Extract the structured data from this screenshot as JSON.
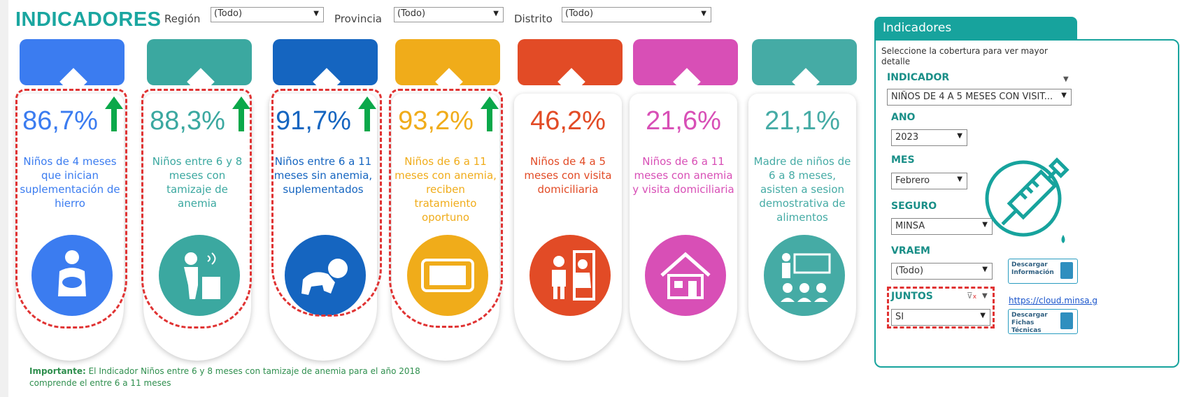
{
  "header": {
    "title": "INDICADORES",
    "filters": [
      {
        "label": "Región",
        "value": "(Todo)"
      },
      {
        "label": "Provincia",
        "value": "(Todo)"
      },
      {
        "label": "Distrito",
        "value": "(Todo)"
      }
    ]
  },
  "indicators": [
    {
      "value": "86,7%",
      "description": "Niños de 4 meses que inician suplementación de hierro",
      "color": "#3b7cf0",
      "icon": "mother-baby-icon",
      "trend": "up",
      "highlighted": true
    },
    {
      "value": "88,3%",
      "description": "Niños entre 6 y 8 meses con tamizaje de anemia",
      "color": "#3ba8a0",
      "icon": "child-testing-icon",
      "trend": "up",
      "highlighted": true
    },
    {
      "value": "91,7%",
      "description": "Niños entre 6 a 11 meses sin anemia, suplementados",
      "color": "#1565c0",
      "icon": "crawling-baby-icon",
      "trend": "up",
      "highlighted": true
    },
    {
      "value": "93,2%",
      "description": "Niños de 6 a 11 meses con anemia, reciben tratamiento oportuno",
      "color": "#f0ac1a",
      "icon": "supplement-pack-icon",
      "trend": "up",
      "highlighted": true
    },
    {
      "value": "46,2%",
      "description": "Niños de 4 a 5 meses con visita domiciliaria",
      "color": "#e24b26",
      "icon": "home-visit-icon",
      "trend": "none",
      "highlighted": false
    },
    {
      "value": "21,6%",
      "description": "Niños de 6 a 11 meses con anemia y visita domiciliaria",
      "color": "#d84fb6",
      "icon": "house-icon",
      "trend": "none",
      "highlighted": false
    },
    {
      "value": "21,1%",
      "description": "Madre de niños de 6 a 8 meses, asisten a sesion demostrativa de alimentos",
      "color": "#45aba5",
      "icon": "demonstration-session-icon",
      "trend": "none",
      "highlighted": false
    }
  ],
  "note": {
    "bold": "Importante:",
    "text": " El Indicador Niños entre 6 y 8 meses con tamizaje de anemia para el año 2018 comprende el entre 6 a 11 meses"
  },
  "panel": {
    "tab_title": "Indicadores",
    "instruction": "Seleccione la cobertura para ver mayor detalle",
    "indicador_label": "INDICADOR",
    "indicador_value": "NIÑOS DE 4 A 5 MESES CON VISIT...",
    "ano_label": "ANO",
    "ano_value": "2023",
    "mes_label": "MES",
    "mes_value": "Febrero",
    "seguro_label": "SEGURO",
    "seguro_value": "MINSA",
    "vraem_label": "VRAEM",
    "vraem_value": "(Todo)",
    "juntos_label": "JUNTOS",
    "juntos_value": "SI",
    "download_info": "Descargar Información",
    "download_sheets": "Descargar Fichas Técnicas",
    "link": "https://cloud.minsa.g",
    "icon": "syringe-icon"
  },
  "colors": {
    "teal": "#17a39d",
    "trend_arrow": "#0aa84a",
    "highlight": "#e03333"
  }
}
